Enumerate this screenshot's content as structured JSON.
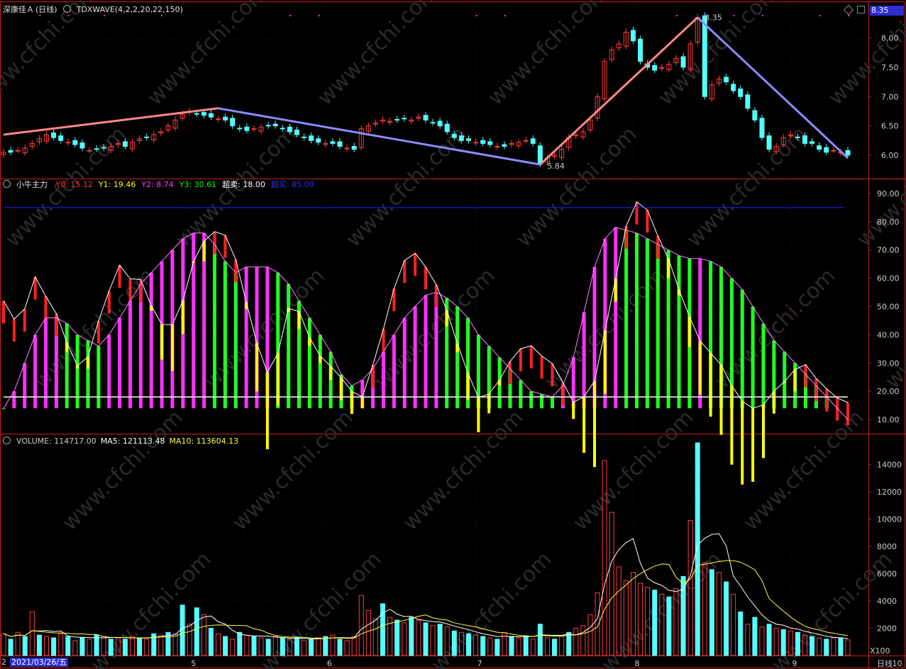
{
  "header": {
    "stock_name": "深康佳Ａ",
    "period_label": "(日线)",
    "wave_indicator": "TDXWAVE(4,2,2,20,22,150)",
    "last_price_tag": "8.35"
  },
  "panel2": {
    "indicator_name": "小牛主力",
    "legend": [
      {
        "label": "Y0: 15.12",
        "color": "#ff3030"
      },
      {
        "label": "Y1: 19.46",
        "color": "#ffff00"
      },
      {
        "label": "Y2: 8.74",
        "color": "#ff40ff"
      },
      {
        "label": "Y3: 30.61",
        "color": "#00ff00"
      },
      {
        "label": "超卖: 18.00",
        "color": "#ffffff"
      },
      {
        "label": "超买: 85.00",
        "color": "#3030ff"
      }
    ]
  },
  "panel3": {
    "legend": [
      {
        "label": "VOLUME: 114717.00",
        "color": "#cccccc"
      },
      {
        "label": "MA5: 121113.48",
        "color": "#ffffff"
      },
      {
        "label": "MA10: 113604.13",
        "color": "#ffff40"
      }
    ],
    "unit_label": "X100"
  },
  "footer": {
    "date_cursor": "2021/03/26/五",
    "period": "日线",
    "cut_label": "2"
  },
  "colors": {
    "up": "#ff3c3c",
    "down": "#54ffff",
    "axis": "#c81e1e",
    "wave_down": "#8c8cff",
    "wave_up": "#ff8888",
    "magenta": "#ff30ff",
    "green": "#20ff20",
    "yellow": "#ffff00",
    "red": "#ff2020"
  },
  "chart_data": [
    {
      "type": "candlestick",
      "title": "TDXWAVE(4,2,2,20,22,150)",
      "y_ticks": [
        "6.00",
        "6.50",
        "7.00",
        "7.50",
        "8.00"
      ],
      "ylim": [
        5.6,
        8.6
      ],
      "close": [
        6.05,
        6.05,
        6.08,
        6.12,
        6.2,
        6.28,
        6.35,
        6.3,
        6.25,
        6.22,
        6.18,
        6.12,
        6.08,
        6.1,
        6.12,
        6.15,
        6.2,
        6.15,
        6.22,
        6.28,
        6.3,
        6.35,
        6.4,
        6.5,
        6.6,
        6.7,
        6.75,
        6.7,
        6.68,
        6.65,
        6.62,
        6.6,
        6.5,
        6.45,
        6.42,
        6.45,
        6.48,
        6.5,
        6.5,
        6.45,
        6.4,
        6.35,
        6.3,
        6.25,
        6.22,
        6.2,
        6.2,
        6.15,
        6.12,
        6.1,
        6.45,
        6.5,
        6.55,
        6.6,
        6.58,
        6.6,
        6.62,
        6.6,
        6.65,
        6.6,
        6.55,
        6.5,
        6.4,
        6.3,
        6.25,
        6.25,
        6.22,
        6.2,
        6.18,
        6.15,
        6.15,
        6.2,
        6.22,
        6.25,
        6.2,
        5.85,
        5.95,
        6.0,
        6.1,
        6.3,
        6.35,
        6.4,
        6.6,
        7.0,
        7.6,
        7.8,
        7.9,
        8.1,
        7.95,
        7.6,
        7.5,
        7.45,
        7.5,
        7.55,
        7.65,
        7.5,
        7.9,
        8.35,
        7.0,
        7.2,
        7.3,
        7.25,
        7.1,
        7.0,
        6.8,
        6.6,
        6.3,
        6.1,
        6.15,
        6.3,
        6.35,
        6.3,
        6.2,
        6.2,
        6.1,
        6.05,
        6.08,
        6.05,
        6.0
      ],
      "wave_points": [
        {
          "i": 0,
          "v": 6.35
        },
        {
          "i": 30,
          "v": 6.8
        },
        {
          "i": 75,
          "v": 5.84,
          "label": "5.84"
        },
        {
          "i": 97,
          "v": 8.35,
          "label": "8.35"
        },
        {
          "i": 118,
          "v": 5.95
        }
      ],
      "x_ticks": [
        {
          "i": 26,
          "label": "5"
        },
        {
          "i": 45,
          "label": "6"
        },
        {
          "i": 66,
          "label": "7"
        },
        {
          "i": 88,
          "label": "8"
        },
        {
          "i": 110,
          "label": "9"
        },
        {
          "i": 124,
          "label": "10"
        }
      ]
    },
    {
      "type": "line",
      "title": "小牛主力",
      "y_ticks": [
        "10.00",
        "20.00",
        "30.00",
        "40.00",
        "50.00",
        "60.00",
        "70.00",
        "80.00",
        "90.00"
      ],
      "ylim": [
        5,
        95
      ],
      "fast": [
        52,
        46,
        44,
        56,
        63,
        52,
        48,
        40,
        30,
        28,
        34,
        46,
        54,
        66,
        62,
        58,
        60,
        50,
        44,
        42,
        46,
        56,
        68,
        73,
        76,
        78,
        72,
        64,
        50,
        38,
        28,
        24,
        42,
        52,
        48,
        40,
        34,
        30,
        28,
        24,
        20,
        16,
        25,
        35,
        46,
        58,
        66,
        70,
        66,
        62,
        56,
        48,
        38,
        30,
        20,
        16,
        20,
        24,
        30,
        33,
        38,
        35,
        32,
        30,
        25,
        18,
        14,
        20,
        24,
        40,
        54,
        72,
        84,
        88,
        84,
        76,
        70,
        62,
        52,
        45,
        38,
        34,
        32,
        26,
        20,
        16,
        14,
        14,
        18,
        22,
        24,
        28,
        30,
        26,
        22,
        20,
        17,
        16
      ],
      "slow": [
        14,
        20,
        30,
        40,
        46,
        46,
        44,
        40,
        38,
        36,
        40,
        46,
        52,
        58,
        62,
        66,
        70,
        74,
        76,
        76,
        72,
        66,
        62,
        64,
        64,
        64,
        62,
        58,
        52,
        46,
        40,
        34,
        26,
        22,
        24,
        28,
        34,
        40,
        46,
        50,
        54,
        55,
        53,
        50,
        46,
        40,
        36,
        32,
        28,
        24,
        20,
        19,
        18,
        22,
        32,
        48,
        64,
        74,
        78,
        77,
        76,
        74,
        72,
        70,
        68,
        67,
        67,
        66,
        64,
        60,
        56,
        50,
        44,
        38,
        34,
        30,
        26,
        22,
        18,
        14,
        10
      ],
      "levels": {
        "oversold": 18,
        "overbought": 85
      }
    },
    {
      "type": "bar",
      "title": "VOLUME",
      "y_ticks": [
        "2000",
        "4000",
        "6000",
        "8000",
        "10000",
        "12000",
        "14000"
      ],
      "ylim": [
        0,
        15800
      ],
      "values": [
        1600,
        1200,
        1700,
        1400,
        3200,
        1500,
        1400,
        1300,
        1600,
        1400,
        1100,
        1300,
        1200,
        1500,
        1400,
        1200,
        1300,
        1200,
        1400,
        1300,
        1200,
        1600,
        1500,
        1700,
        1600,
        3700,
        2300,
        3500,
        3000,
        2000,
        1600,
        1400,
        1200,
        1700,
        1500,
        1400,
        1300,
        1200,
        1400,
        1300,
        1200,
        1300,
        1100,
        1200,
        1300,
        1400,
        1500,
        1200,
        1100,
        1400,
        4400,
        3300,
        2700,
        3800,
        2800,
        2600,
        2400,
        2800,
        2600,
        2400,
        2200,
        2300,
        2100,
        1800,
        1700,
        1600,
        1500,
        1400,
        1300,
        1200,
        1700,
        1400,
        1300,
        1400,
        1200,
        2300,
        1300,
        1200,
        1400,
        1700,
        2000,
        2200,
        3000,
        4600,
        14300,
        10500,
        6500,
        5500,
        6100,
        5300,
        5000,
        4800,
        4500,
        4300,
        4900,
        5800,
        9900,
        15600,
        6800,
        6300,
        6100,
        5400,
        4500,
        3200,
        2300,
        2800,
        2100,
        2300,
        2000,
        1900,
        1800,
        1700,
        1500,
        1400,
        1300,
        1200,
        1300,
        1300,
        1148
      ]
    }
  ]
}
